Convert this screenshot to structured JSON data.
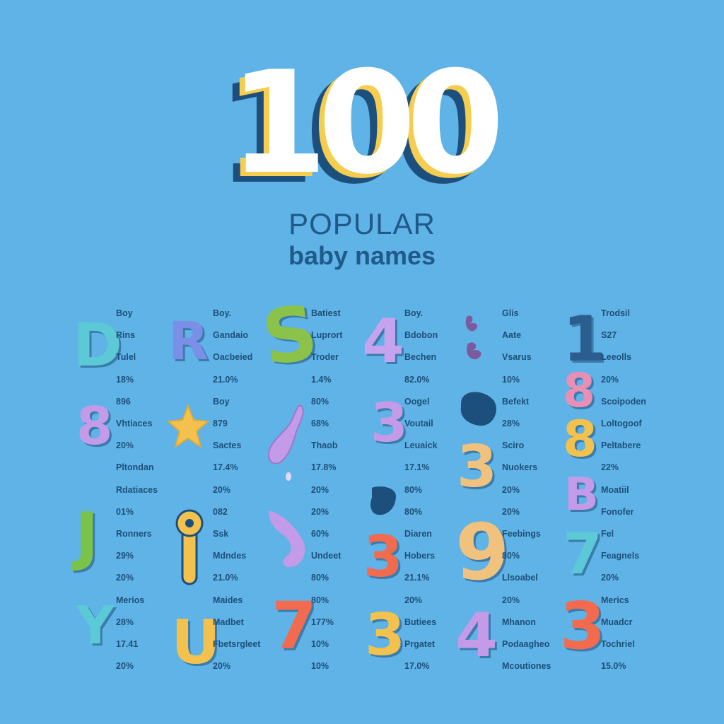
{
  "hero": {
    "number": "100",
    "line1": "POPULAR",
    "line2": "baby names"
  },
  "colors": {
    "background": "#5fb3e6",
    "navy": "#1d4f7c",
    "yellow": "#f6cd4f",
    "white": "#ffffff"
  },
  "glyphs": [
    {
      "char": "D",
      "color": "#5cc9d6"
    },
    {
      "char": "R",
      "color": "#7c8fe6"
    },
    {
      "char": "S",
      "color": "#8ac24a"
    },
    {
      "char": "4",
      "color": "#c6a3ee"
    },
    {
      "char": "1",
      "color": "#2b5d8f"
    },
    {
      "char": "8",
      "color": "#c49be8"
    },
    {
      "char": "3",
      "color": "#c49be8"
    },
    {
      "char": "8",
      "color": "#e98fb6"
    },
    {
      "char": "8",
      "color": "#f3c24e"
    },
    {
      "char": "3",
      "color": "#f0c27e"
    },
    {
      "char": "B",
      "color": "#c49be8"
    },
    {
      "char": "J",
      "color": "#7bc24a"
    },
    {
      "char": "3",
      "color": "#f26b4f"
    },
    {
      "char": "9",
      "color": "#f0c27e"
    },
    {
      "char": "7",
      "color": "#5cc9d6"
    },
    {
      "char": "Y",
      "color": "#5cc9d6"
    },
    {
      "char": "U",
      "color": "#f3c24e"
    },
    {
      "char": "7",
      "color": "#f26b4f"
    },
    {
      "char": "3",
      "color": "#f3c24e"
    },
    {
      "char": "4",
      "color": "#c49be8"
    },
    {
      "char": "3",
      "color": "#f26b4f"
    }
  ],
  "columns": [
    [
      "Boy",
      "Rins",
      "Tulel",
      "18%",
      "896",
      "Vhtiaces",
      "20%",
      "Pltondan",
      "Rdatiaces",
      "01%",
      "Ronners",
      "29%",
      "20%",
      "Merios",
      "28%",
      "17.41",
      "20%"
    ],
    [
      "Boy.",
      "Gandaio",
      "Oacbeied",
      "21.0%",
      "Boy",
      "879",
      "Sactes",
      "17.4%",
      "20%",
      "082",
      "Ssk",
      "Mdndes",
      "21.0%",
      "Maides",
      "Madbet",
      "Fbetsrgleet",
      "20%"
    ],
    [
      "Batiest",
      "Luprort",
      "Troder",
      "1.4%",
      "80%",
      "68%",
      "Thaob",
      "17.8%",
      "20%",
      "20%",
      "60%",
      "Undeet",
      "80%",
      "80%",
      "177%",
      "10%",
      "10%"
    ],
    [
      "Boy.",
      "Bdobon",
      "Bechen",
      "82.0%",
      "Oogel",
      "Voutail",
      "Leuaick",
      "17.1%",
      "80%",
      "80%",
      "Diaren",
      "Hobers",
      "21.1%",
      "20%",
      "Butiees",
      "Prgatet",
      "17.0%"
    ],
    [
      "Glis",
      "Aate",
      "Vsarus",
      "10%",
      "Befekt",
      "28%",
      "Sciro",
      "Nuokers",
      "20%",
      "20%",
      "Feebings",
      "80%",
      "Llsoabel",
      "20%",
      "Mhanon",
      "Podaagheo",
      "Mcoutiones"
    ],
    [
      "Trodsil",
      "S27",
      "Leeolls",
      "20%",
      "Scoipoden",
      "Loltogoof",
      "Peltabere",
      "22%",
      "Moatiil",
      "Fonofer",
      "Fel",
      "Feagnels",
      "20%",
      "Merics",
      "Muadcr",
      "Tochriel",
      "15.0%"
    ]
  ]
}
